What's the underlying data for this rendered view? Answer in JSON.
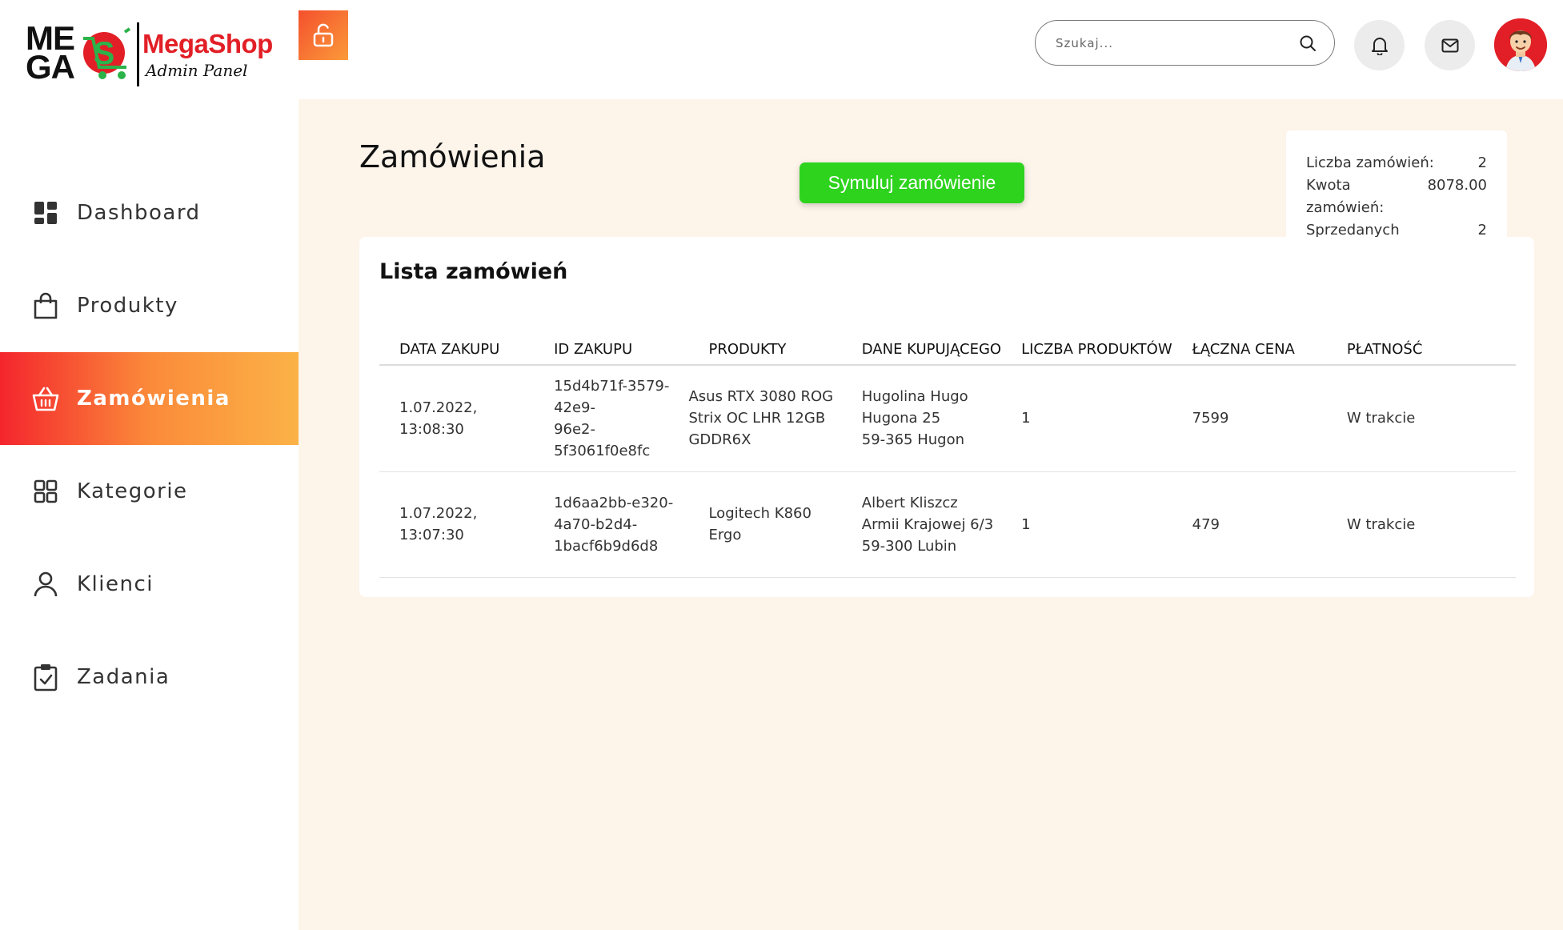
{
  "brand": {
    "logo_word_top": "ME",
    "logo_word_bottom": "GA",
    "title": "MegaShop",
    "subtitle": "Admin Panel",
    "accent_color": "#e21f26"
  },
  "sidebar": {
    "items": [
      {
        "label": "Dashboard",
        "icon": "dashboard-icon",
        "active": false
      },
      {
        "label": "Produkty",
        "icon": "shopping-bag-icon",
        "active": false
      },
      {
        "label": "Zamówienia",
        "icon": "basket-icon",
        "active": true
      },
      {
        "label": "Kategorie",
        "icon": "category-grid-icon",
        "active": false
      },
      {
        "label": "Klienci",
        "icon": "user-icon",
        "active": false
      },
      {
        "label": "Zadania",
        "icon": "clipboard-check-icon",
        "active": false
      }
    ]
  },
  "header": {
    "lock_icon": "unlock-icon",
    "search_placeholder": "Szukaj...",
    "search_value": "",
    "notification_icon": "bell-icon",
    "mail_icon": "mail-icon"
  },
  "main": {
    "page_title": "Zamówienia",
    "simulate_button": "Symuluj zamówienie",
    "stats": [
      {
        "label": "Liczba zamówień:",
        "value": "2"
      },
      {
        "label": "Kwota zamówień:",
        "value": "8078.00"
      },
      {
        "label": "Sprzedanych produktów:",
        "value": "2"
      }
    ],
    "orders_card": {
      "title": "Lista zamówień",
      "columns": [
        "DATA ZAKUPU",
        "ID ZAKUPU",
        "PRODUKTY",
        "DANE KUPUJĄCEGO",
        "LICZBA PRODUKTÓW",
        "ŁĄCZNA CENA",
        "PŁATNOŚĆ"
      ],
      "rows": [
        {
          "date": "1.07.2022, 13:08:30",
          "id": "15d4b71f-3579-42e9-\n96e2-5f3061f0e8fc",
          "products": "Asus RTX 3080 ROG\nStrix OC LHR 12GB\nGDDR6X",
          "buyer": "Hugolina Hugo\nHugona 25\n59-365 Hugon",
          "quantity": "1",
          "total": "7599",
          "payment": "W trakcie"
        },
        {
          "date": "1.07.2022, 13:07:30",
          "id": "1d6aa2bb-e320-\n4a70-b2d4-\n1bacf6b9d6d8",
          "products": "Logitech K860 Ergo",
          "buyer": "Albert Kliszcz\nArmii Krajowej 6/3\n59-300 Lubin",
          "quantity": "1",
          "total": "479",
          "payment": "W trakcie"
        }
      ]
    }
  }
}
